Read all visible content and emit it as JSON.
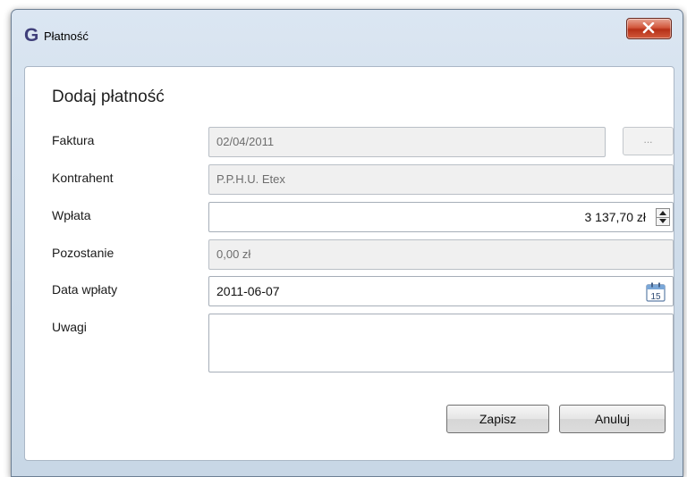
{
  "window": {
    "title": "Płatność",
    "app_icon_glyph": "G"
  },
  "titlebar": {
    "close_icon": "close-icon"
  },
  "form": {
    "heading": "Dodaj płatność",
    "faktura": {
      "label": "Faktura",
      "value": "02/04/2011",
      "browse_label": "..."
    },
    "kontrahent": {
      "label": "Kontrahent",
      "value": "P.P.H.U. Etex"
    },
    "wplata": {
      "label": "Wpłata",
      "value": "3 137,70 zł"
    },
    "pozostanie": {
      "label": "Pozostanie",
      "value": "0,00 zł"
    },
    "data_wplaty": {
      "label": "Data wpłaty",
      "value": "2011-06-07",
      "calendar_day": "15"
    },
    "uwagi": {
      "label": "Uwagi",
      "value": ""
    }
  },
  "buttons": {
    "save": "Zapisz",
    "cancel": "Anuluj"
  },
  "colors": {
    "accent_title": "#3f3f7a",
    "close_red": "#c8472b",
    "frame": "#cddbe9"
  }
}
